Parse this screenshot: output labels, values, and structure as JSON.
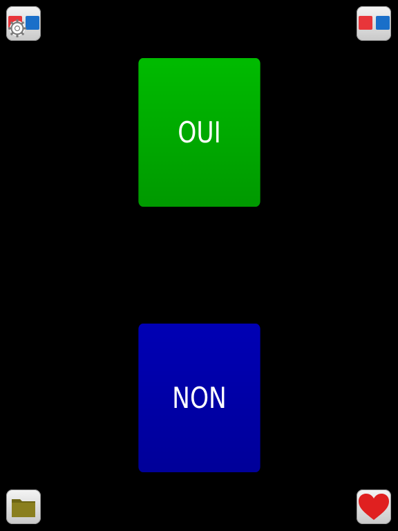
{
  "buttons": {
    "yes_label": "OUI",
    "no_label": "NON"
  },
  "icons": {
    "top_left": "settings-gear-icon",
    "top_right": "red-blue-squares-icon",
    "bottom_left": "folder-icon",
    "bottom_right": "heart-icon"
  },
  "colors": {
    "background": "#000000",
    "yes": "#00aa00",
    "no": "#0000aa",
    "red": "#e8353a",
    "blue": "#1a6fc9",
    "folder": "#8a7f1e",
    "heart": "#e02020"
  }
}
